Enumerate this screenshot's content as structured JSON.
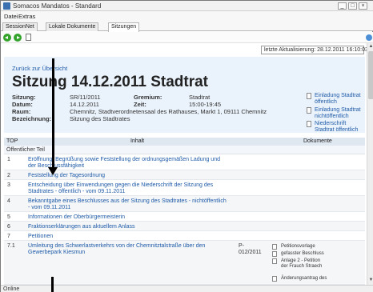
{
  "window": {
    "title": "Somacos Mandatos - Standard",
    "minimize": "_",
    "maximize": "□",
    "close": "×"
  },
  "menu": [
    "Datei",
    "Extras"
  ],
  "tabs": [
    {
      "label": "SessionNet"
    },
    {
      "label": "Lokale Dokumente"
    },
    {
      "label": "Sitzungen"
    }
  ],
  "page": {
    "last_update": "letzte Aktualisierung: 28.12.2011 16:10:03",
    "back_link": "Zurück zur Übersicht",
    "headline": "Sitzung 14.12.2011 Stadtrat"
  },
  "meta": {
    "sitzung_label": "Sitzung:",
    "sitzung_value": "SR/11/2011",
    "gremium_label": "Gremium:",
    "gremium_value": "Stadtrat",
    "datum_label": "Datum:",
    "datum_value": "14.12.2011",
    "zeit_label": "Zeit:",
    "zeit_value": "15:00-19:45",
    "raum_label": "Raum:",
    "raum_value": "Chemnitz, Stadtverordnetensaal des Rathauses, Markt 1, 09111 Chemnitz",
    "bezeichnung_label": "Bezeichnung:",
    "bezeichnung_value": "Sitzung des Stadtrates"
  },
  "header_docs": [
    "Einladung Stadtrat öffentlich",
    "Einladung Stadtrat nichtöffentlich",
    "Niederschrift Stadtrat öffentlich"
  ],
  "table": {
    "col_top": "TOP",
    "col_inhalt": "Inhalt",
    "col_dokumente": "Dokumente",
    "section": "Öffentlicher Teil",
    "rows": [
      {
        "num": "1",
        "text": "Eröffnung, Begrüßung sowie Feststellung der ordnungsgemäßen Ladung und der Beschlussfähigkeit"
      },
      {
        "num": "2",
        "text": "Feststellung der Tagesordnung"
      },
      {
        "num": "3",
        "text": "Entscheidung über Einwendungen gegen die Niederschrift der Sitzung des Stadtrates - öffentlich - vom 09.11.2011"
      },
      {
        "num": "4",
        "text": "Bekanntgabe eines Beschlusses aus der Sitzung des Stadtrates - nichtöffentlich - vom 09.11.2011"
      },
      {
        "num": "5",
        "text": "Informationen der Oberbürgermeisterin"
      },
      {
        "num": "6",
        "text": "Fraktionserklärungen aus aktuellem Anlass"
      },
      {
        "num": "7",
        "text": "Petitionen"
      },
      {
        "num": "7.1",
        "text": "Umleitung des Schwerlastverkehrs von der Chemnitztalstraße über den Gewerbepark Kiesmun",
        "ref": "P-012/2011"
      }
    ],
    "row71_docs": [
      "Petitionsvorlage",
      "gefasster Beschluss",
      "Anlage 2 - Petition der Frauch Straech",
      "Änderungsantrag des"
    ]
  },
  "status": "Online"
}
